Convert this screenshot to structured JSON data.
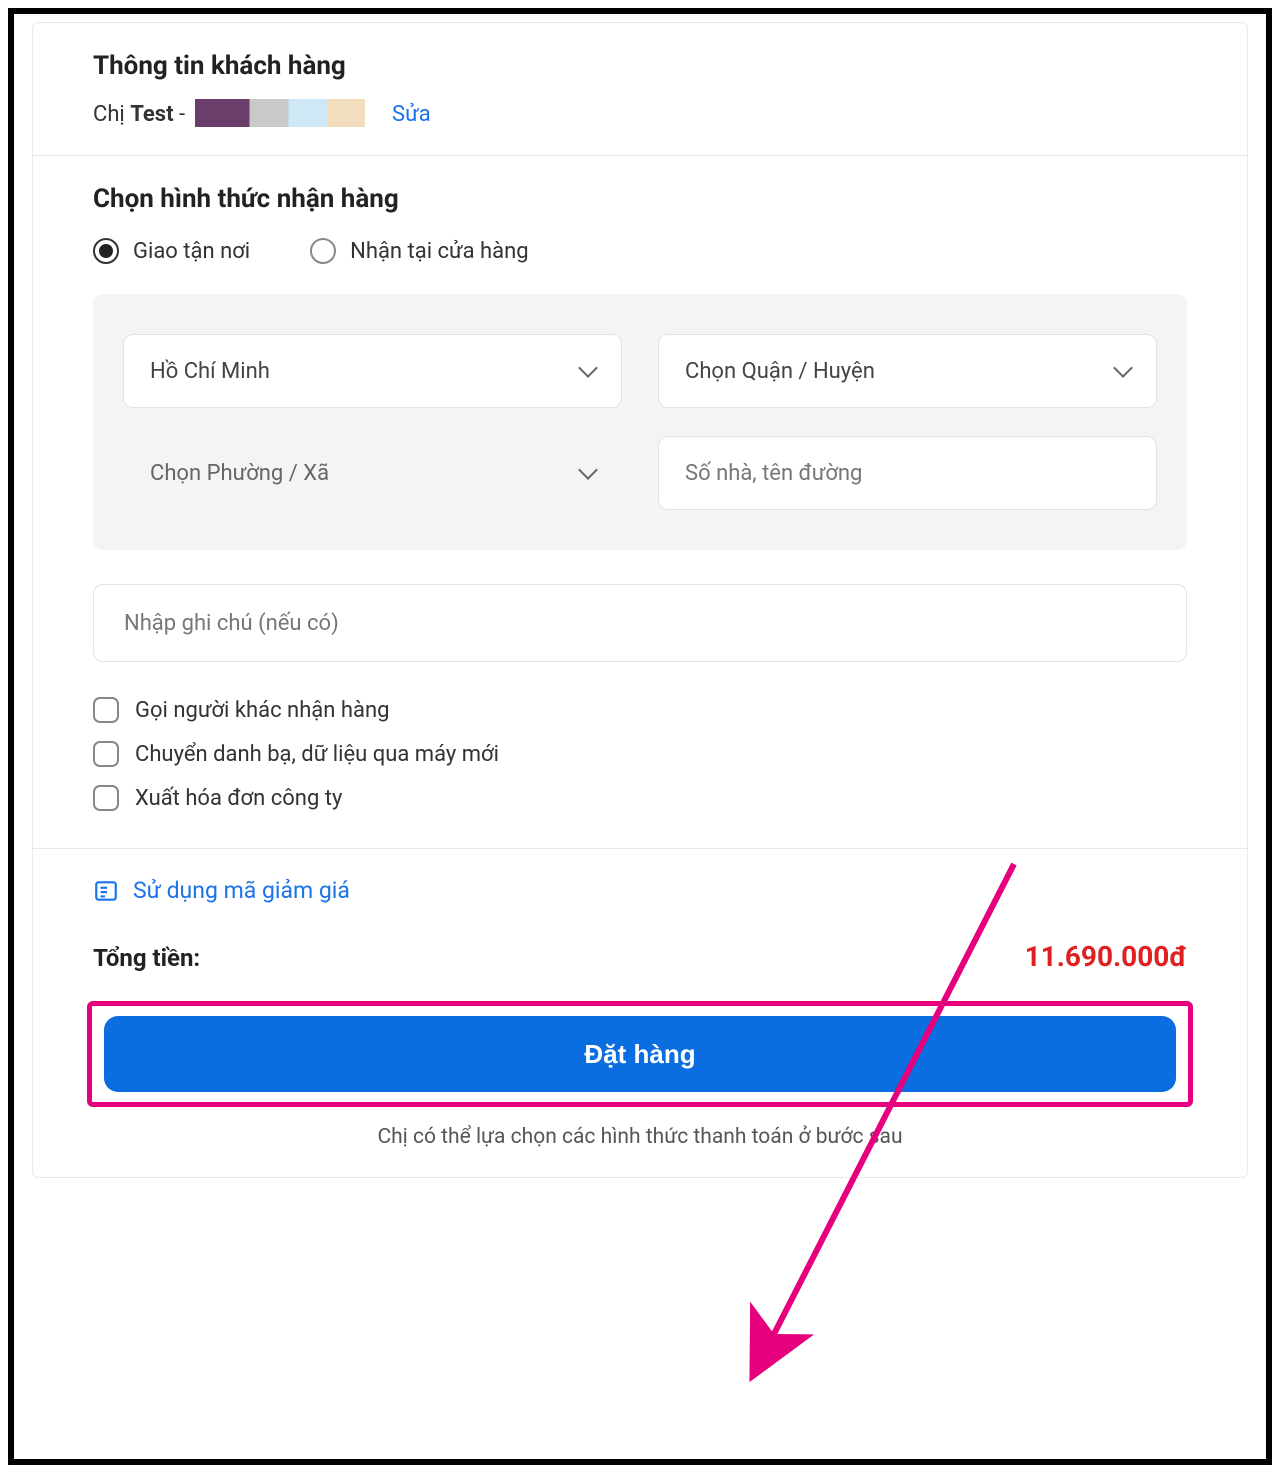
{
  "customer": {
    "section_title": "Thông tin khách hàng",
    "salutation": "Chị",
    "name": "Test",
    "edit_label": "Sửa"
  },
  "delivery": {
    "section_title": "Chọn hình thức nhận hàng",
    "radio": {
      "home": "Giao tận nơi",
      "store": "Nhận tại cửa hàng"
    },
    "address": {
      "city": "Hồ Chí Minh",
      "district_placeholder": "Chọn Quận / Huyện",
      "ward_placeholder": "Chọn Phường / Xã",
      "street_placeholder": "Số nhà, tên đường"
    },
    "note_placeholder": "Nhập ghi chú (nếu có)",
    "checkboxes": {
      "other_receiver": "Gọi người khác nhận hàng",
      "data_transfer": "Chuyển danh bạ, dữ liệu qua máy mới",
      "company_invoice": "Xuất hóa đơn công ty"
    }
  },
  "summary": {
    "promo_label": "Sử dụng mã giảm giá",
    "total_label": "Tổng tiền:",
    "total_value": "11.690.000đ",
    "order_button": "Đặt hàng",
    "footnote": "Chị có thể lựa chọn các hình thức thanh toán ở bước sau"
  }
}
